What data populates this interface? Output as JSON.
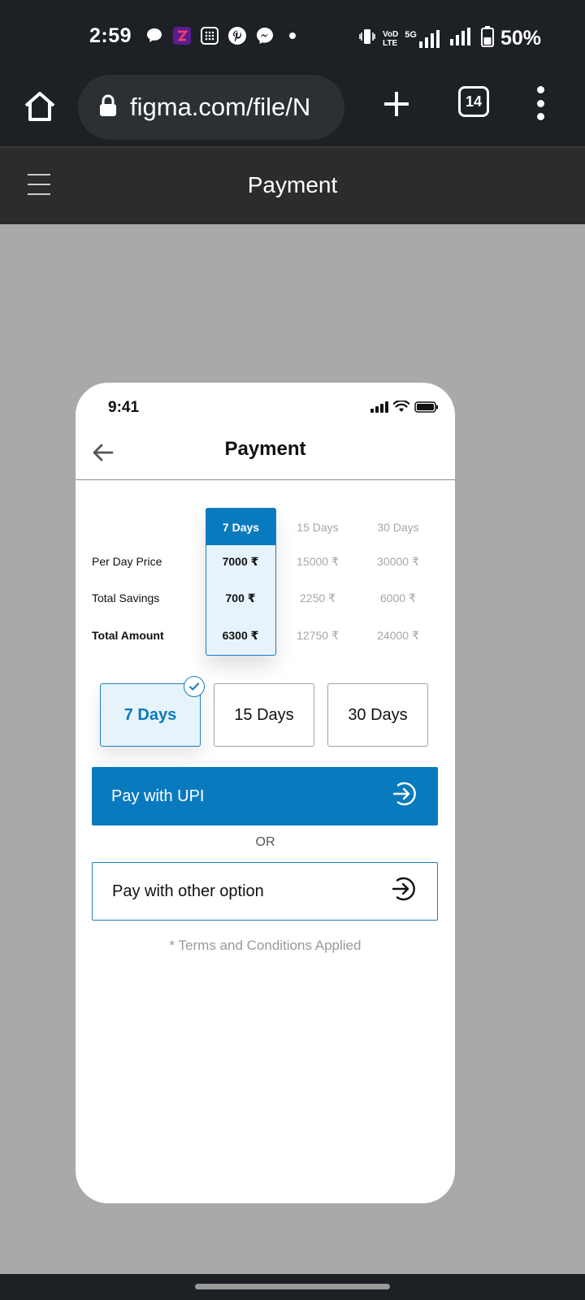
{
  "system": {
    "time": "2:59",
    "battery": "50%",
    "network_5g": "5G",
    "volte_top": "VoD",
    "volte_bottom": "LTE"
  },
  "browser": {
    "url": "figma.com/file/N",
    "tab_count": "14"
  },
  "figma": {
    "title": "Payment"
  },
  "phone": {
    "status_time": "9:41",
    "header_title": "Payment"
  },
  "pricing": {
    "columns": [
      "7 Days",
      "15 Days",
      "30 Days"
    ],
    "rows": [
      {
        "label": "Per Day Price",
        "values": [
          "7000 ₹",
          "15000 ₹",
          "30000 ₹"
        ]
      },
      {
        "label": "Total Savings",
        "values": [
          "700 ₹",
          "2250 ₹",
          "6000 ₹"
        ]
      },
      {
        "label": "Total Amount",
        "values": [
          "6300 ₹",
          "12750 ₹",
          "24000 ₹"
        ]
      }
    ]
  },
  "durations": {
    "options": [
      "7 Days",
      "15 Days",
      "30 Days"
    ],
    "selected": "7 Days"
  },
  "actions": {
    "upi_label": "Pay with UPI",
    "or_label": "OR",
    "other_label": "Pay with other option",
    "terms": "* Terms and Conditions Applied"
  },
  "colors": {
    "accent": "#0a7abf",
    "accent_light": "#e7f3fb"
  }
}
